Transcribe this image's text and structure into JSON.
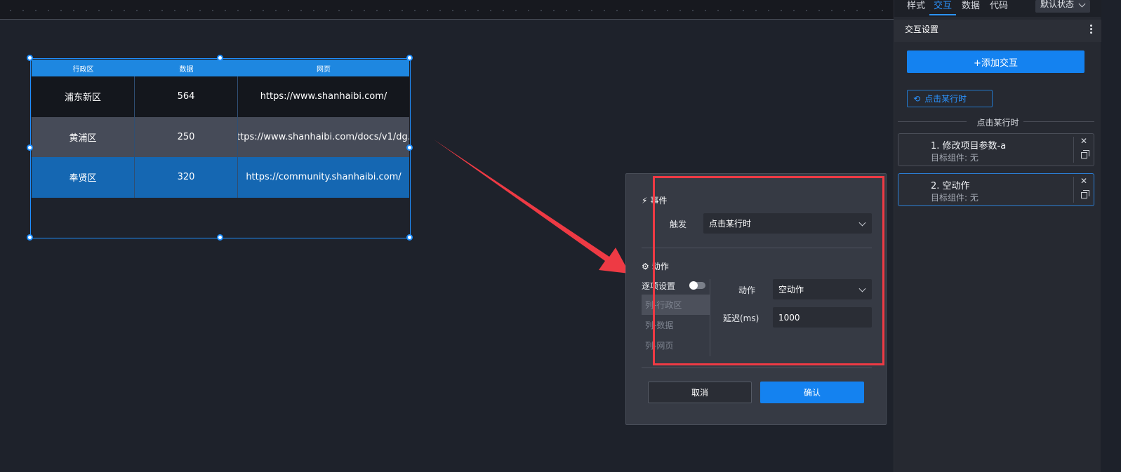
{
  "table": {
    "headers": [
      "行政区",
      "数据",
      "网页"
    ],
    "rows": [
      [
        "浦东新区",
        "564",
        "https://www.shanhaibi.com/"
      ],
      [
        "黄浦区",
        "250",
        "https://www.shanhaibi.com/docs/v1/dg..."
      ],
      [
        "奉贤区",
        "320",
        "https://community.shanhaibi.com/"
      ]
    ]
  },
  "dialog": {
    "event_title": "事件",
    "trigger_label": "触发",
    "trigger_value": "点击某行时",
    "action_title": "动作",
    "per_item_label": "逐项设置",
    "columns": [
      "列-行政区",
      "列-数据",
      "列-网页"
    ],
    "action_label": "动作",
    "action_value": "空动作",
    "delay_label": "延迟(ms)",
    "delay_value": "1000",
    "cancel": "取消",
    "confirm": "确认"
  },
  "panel": {
    "tabs": [
      "样式",
      "交互",
      "数据",
      "代码"
    ],
    "active_tab": "交互",
    "state_select": "默认状态",
    "header_title": "交互设置",
    "add_button": "+添加交互",
    "trigger_chip": "点击某行时",
    "section_label": "点击某行时",
    "cards": [
      {
        "title": "1. 修改项目参数-a",
        "subtitle": "目标组件: 无"
      },
      {
        "title": "2. 空动作",
        "subtitle": "目标组件: 无"
      }
    ]
  },
  "colors": {
    "accent": "#1482f0",
    "annotation_red": "#ee3a44"
  }
}
